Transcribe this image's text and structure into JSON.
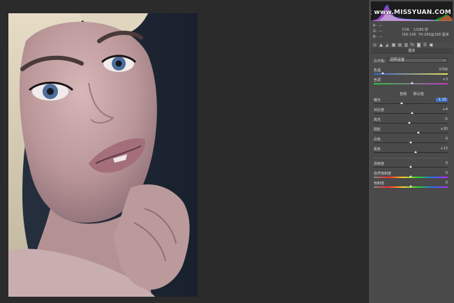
{
  "watermark": "思缘设计论坛 www.MISSYUAN.COM",
  "readout": {
    "r_label": "R:",
    "r_value": "---",
    "g_label": "G:",
    "g_value": "---",
    "b_label": "B:",
    "b_value": "---",
    "aperture": "f/16",
    "shutter": "1/160 秒",
    "iso": "ISO 100",
    "lens": "70-200@168 毫米"
  },
  "panel": {
    "section_title": "基本",
    "wb_label": "白平衡:",
    "wb_value": "原照设置",
    "auto_label": "自动",
    "default_label": "默认值"
  },
  "sliders": {
    "temp": {
      "label": "色温",
      "value": "3700",
      "pos": 0.12
    },
    "tint": {
      "label": "色调",
      "value": "+3",
      "pos": 0.52
    },
    "exposure": {
      "label": "曝光",
      "value": "-1.15",
      "pos": 0.38
    },
    "contrast": {
      "label": "对比度",
      "value": "+4",
      "pos": 0.52
    },
    "highlights": {
      "label": "高光",
      "value": "-5",
      "pos": 0.48
    },
    "shadows": {
      "label": "阴影",
      "value": "+20",
      "pos": 0.6
    },
    "whites": {
      "label": "白色",
      "value": "0",
      "pos": 0.5
    },
    "blacks": {
      "label": "黑色",
      "value": "+13",
      "pos": 0.57
    },
    "clarity": {
      "label": "清晰度",
      "value": "0",
      "pos": 0.5
    },
    "vibrance": {
      "label": "自然饱和度",
      "value": "0",
      "pos": 0.5
    },
    "saturation": {
      "label": "饱和度",
      "value": "0",
      "pos": 0.5
    }
  },
  "tools": [
    "camera-icon",
    "triangle-icon",
    "curve-icon",
    "detail-icon",
    "hsl-icon",
    "split-tone-icon",
    "lens-icon",
    "fx-icon",
    "camera-calib-icon",
    "presets-icon",
    "snapshot-icon"
  ],
  "colors": {
    "active": "#3c6ebd",
    "panel": "#4a4a4a",
    "background": "#2b2b2b"
  }
}
